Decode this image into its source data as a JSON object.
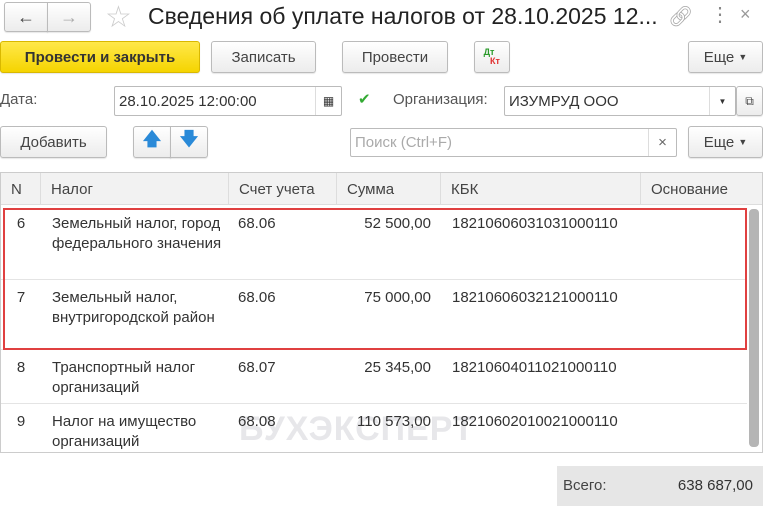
{
  "window": {
    "title": "Сведения об уплате налогов от 28.10.2025 12..."
  },
  "toolbar": {
    "post_close": "Провести и закрыть",
    "save": "Записать",
    "post": "Провести",
    "dt": "Дт",
    "kt": "Кт",
    "more": "Еще"
  },
  "form": {
    "date_label": "Дата:",
    "date_value": "28.10.2025 12:00:00",
    "org_label": "Организация:",
    "org_value": "ИЗУМРУД ООО"
  },
  "table_toolbar": {
    "add": "Добавить",
    "search_placeholder": "Поиск (Ctrl+F)",
    "clear": "×",
    "more": "Еще"
  },
  "table": {
    "columns": [
      "N",
      "Налог",
      "Счет учета",
      "Сумма",
      "КБК",
      "Основание"
    ],
    "rows": [
      {
        "n": "6",
        "tax": "Земельный налог, город федерального значения",
        "account": "68.06",
        "sum": "52 500,00",
        "kbk": "18210606031031000110",
        "basis": ""
      },
      {
        "n": "7",
        "tax": "Земельный налог, внутригородской район",
        "account": "68.06",
        "sum": "75 000,00",
        "kbk": "18210606032121000110",
        "basis": ""
      },
      {
        "n": "8",
        "tax": "Транспортный налог организаций",
        "account": "68.07",
        "sum": "25 345,00",
        "kbk": "18210604011021000110",
        "basis": ""
      },
      {
        "n": "9",
        "tax": "Налог на имущество организаций",
        "account": "68.08",
        "sum": "110 573,00",
        "kbk": "18210602010021000110",
        "basis": ""
      }
    ]
  },
  "watermark": "БУХЭКСПЕРТ",
  "footer": {
    "total_label": "Всего:",
    "total_value": "638 687,00"
  }
}
